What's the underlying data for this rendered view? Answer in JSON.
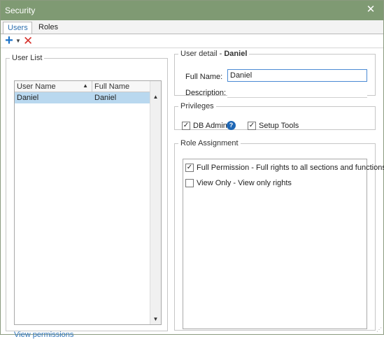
{
  "window": {
    "title": "Security",
    "close_symbol": "✕"
  },
  "tabs": [
    {
      "label": "Users",
      "active": true
    },
    {
      "label": "Roles",
      "active": false
    }
  ],
  "toolbar": {
    "add_icon": "plus-icon",
    "dropdown_icon": "caret-down-icon",
    "delete_icon": "x-icon",
    "add_color": "#1e74c8",
    "delete_color": "#d6322c"
  },
  "user_list": {
    "legend": "User List",
    "columns": [
      {
        "label": "User Name",
        "sorted": "ascending"
      },
      {
        "label": "Full Name"
      }
    ],
    "rows": [
      {
        "user_name": "Daniel",
        "full_name": "Daniel",
        "selected": true
      }
    ],
    "view_permissions_label": "View permissions"
  },
  "user_detail": {
    "legend_prefix": "User detail -",
    "legend_user": "Daniel",
    "full_name_label": "Full Name:",
    "full_name_value": "Daniel",
    "description_label": "Description:",
    "description_value": ""
  },
  "privileges": {
    "legend": "Privileges",
    "items": [
      {
        "label": "DB Admin",
        "checked": true
      },
      {
        "label": "Setup Tools",
        "checked": true
      }
    ]
  },
  "role_assignment": {
    "legend": "Role Assignment",
    "roles": [
      {
        "text": "Full Permission  -  Full rights to all sections and functions",
        "checked": true
      },
      {
        "text": "View Only  -  View only rights",
        "checked": false
      }
    ]
  },
  "colors": {
    "titlebar": "#7f9a73",
    "selection": "#b9d8ef",
    "link": "#2e73b8",
    "accent": "#2e6fae"
  }
}
